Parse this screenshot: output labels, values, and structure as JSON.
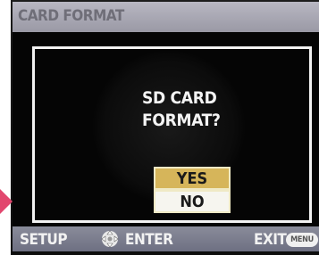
{
  "header": {
    "title": "CARD FORMAT"
  },
  "dialog": {
    "message_line1": "SD CARD",
    "message_line2": "FORMAT?",
    "options": [
      {
        "label": "YES",
        "selected": true
      },
      {
        "label": "NO",
        "selected": false
      }
    ]
  },
  "footer": {
    "setup_label": "SETUP",
    "dpad_icon": "dpad-icon",
    "enter_label": "ENTER",
    "exit_label": "EXIT",
    "menu_button_label": "MENU"
  },
  "colors": {
    "header_bg": "#a9a8b3",
    "selected_bg": "#d6b55a",
    "unselected_bg": "#f6f5ef",
    "footer_bg": "#7d7f8e",
    "pointer": "#e2476e"
  }
}
